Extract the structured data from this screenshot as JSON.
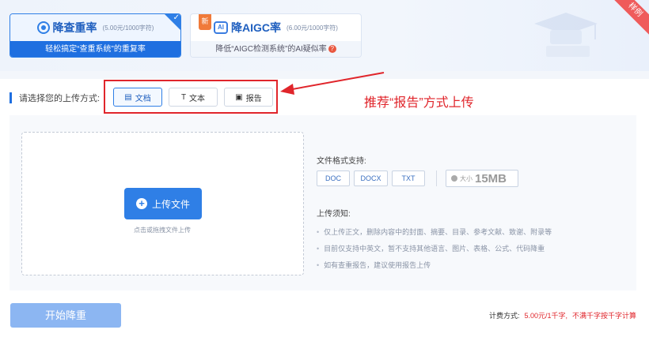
{
  "services": [
    {
      "title": "降查重率",
      "price": "(5.00元/1000字符)",
      "desc": "轻松搞定“查重系统”的重复率",
      "selected": true
    },
    {
      "badge": "新",
      "title": "降AIGC率",
      "price": "(6.00元/1000字符)",
      "desc": "降低“AIGC检测系统”的AI疑似率",
      "help": "?"
    }
  ],
  "ribbon": "样例",
  "upload": {
    "choose_label": "请选择您的上传方式:",
    "methods": [
      "文档",
      "文本",
      "报告"
    ],
    "note": "推荐“报告”方式上传",
    "upload_button": "上传文件",
    "drag_hint": "点击或拖拽文件上传",
    "format_title": "文件格式支持:",
    "formats": [
      "DOC",
      "DOCX",
      "TXT"
    ],
    "size_small": "大小",
    "size_value": "15MB",
    "notice_title": "上传须知:",
    "notices": [
      "仅上传正文，删除内容中的封面、摘要、目录、参考文献、致谢、附录等",
      "目前仅支持中英文，暂不支持其他语言、图片、表格、公式、代码降重",
      "如有查重报告，建议使用报告上传"
    ]
  },
  "footer": {
    "start_button": "开始降重",
    "fee_label": "计费方式:",
    "fee_value": "5.00元/1千字,",
    "fee_extra": "不满千字按千字计算"
  }
}
